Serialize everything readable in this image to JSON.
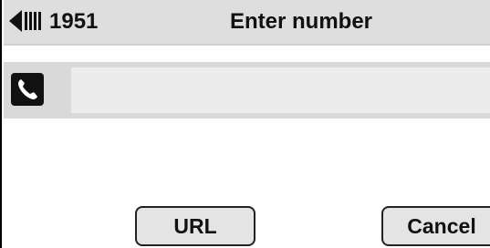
{
  "header": {
    "line_number": "1951",
    "title": "Enter number",
    "line_indicator_icon": "line-status-icon"
  },
  "entry": {
    "icon": "phone-handset-icon",
    "value": ""
  },
  "softkeys": [
    {
      "label": "URL"
    },
    {
      "label": "Cancel"
    }
  ],
  "colors": {
    "header_background": "#dedede",
    "entry_background": "#d9d9d9",
    "field_background": "#ececec",
    "softkey_background": "#e4e4e4"
  }
}
